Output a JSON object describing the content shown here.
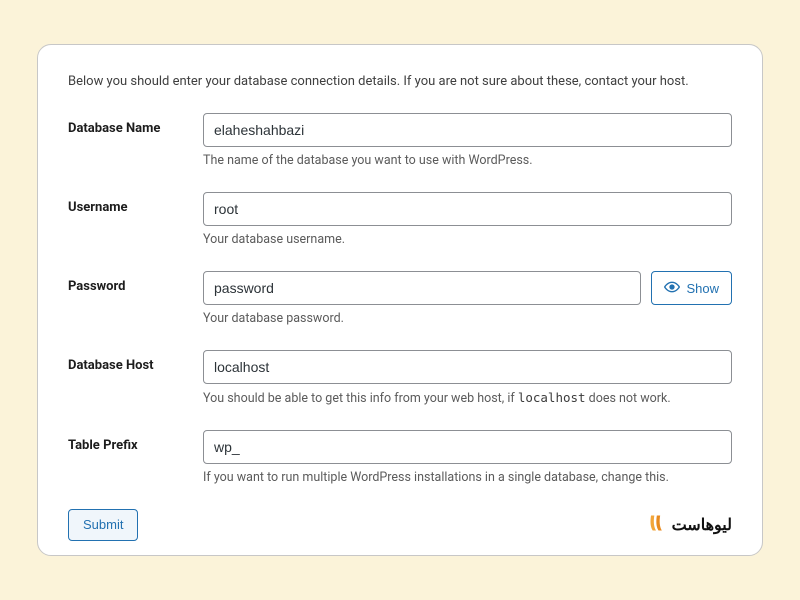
{
  "intro": "Below you should enter your database connection details. If you are not sure about these, contact your host.",
  "fields": {
    "dbname": {
      "label": "Database Name",
      "value": "elaheshahbazi",
      "help": "The name of the database you want to use with WordPress."
    },
    "username": {
      "label": "Username",
      "value": "root",
      "help": "Your database username."
    },
    "password": {
      "label": "Password",
      "value": "password",
      "help": "Your database password.",
      "show_label": "Show"
    },
    "dbhost": {
      "label": "Database Host",
      "value": "localhost",
      "help_before": "You should be able to get this info from your web host, if ",
      "help_code": "localhost",
      "help_after": " does not work."
    },
    "prefix": {
      "label": "Table Prefix",
      "value": "wp_",
      "help": "If you want to run multiple WordPress installations in a single database, change this."
    }
  },
  "submit_label": "Submit",
  "brand": "ليوهاست"
}
